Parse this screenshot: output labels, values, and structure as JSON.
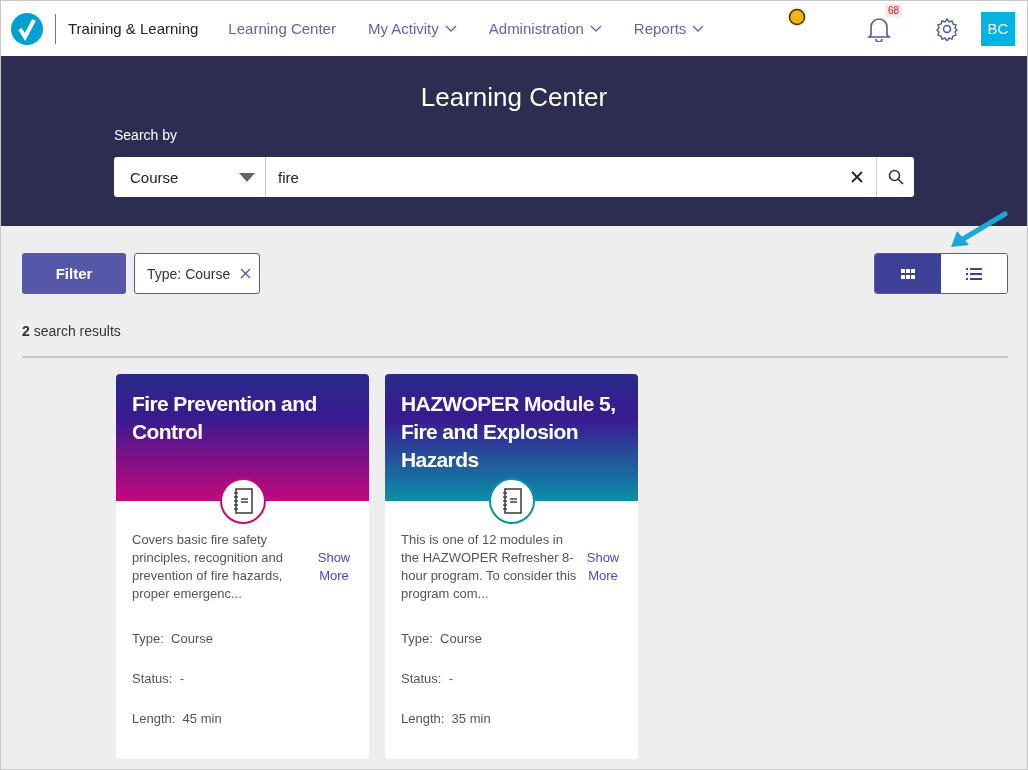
{
  "nav": {
    "brand": "Training & Learning",
    "items": [
      {
        "label": "Learning Center",
        "dropdown": false
      },
      {
        "label": "My Activity",
        "dropdown": true
      },
      {
        "label": "Administration",
        "dropdown": true
      },
      {
        "label": "Reports",
        "dropdown": true
      }
    ],
    "notifications": "68",
    "avatar": "BC"
  },
  "header": {
    "title": "Learning Center",
    "search_label": "Search by",
    "search_type": "Course",
    "query": "fire"
  },
  "toolbar": {
    "filter": "Filter",
    "chips": [
      "Type: Course"
    ],
    "views": [
      {
        "kind": "grid",
        "selected": true
      },
      {
        "kind": "list",
        "selected": false
      }
    ]
  },
  "results_count": "**2** search results",
  "cards": [
    {
      "title": "Fire Prevention and Control",
      "color": "#c4087c",
      "description": "Covers basic fire safety principles, recognition and prevention of fire hazards, proper emergenc...",
      "show_more": "Show More",
      "fields": [
        {
          "label": "Type:",
          "value": "Course"
        },
        {
          "label": "Status:",
          "value": "-"
        },
        {
          "label": "Length:",
          "value": "45 min"
        }
      ]
    },
    {
      "title": "HAZWOPER Module 5, Fire and Explosion Hazards",
      "color": "#0a90a8",
      "description": "This is one of 12 modules in the HAZWOPER Refresher 8-hour program. To consider this program com...",
      "show_more": "Show More",
      "fields": [
        {
          "label": "Type:",
          "value": "Course"
        },
        {
          "label": "Status:",
          "value": "-"
        },
        {
          "label": "Length:",
          "value": "35 min"
        }
      ]
    }
  ]
}
